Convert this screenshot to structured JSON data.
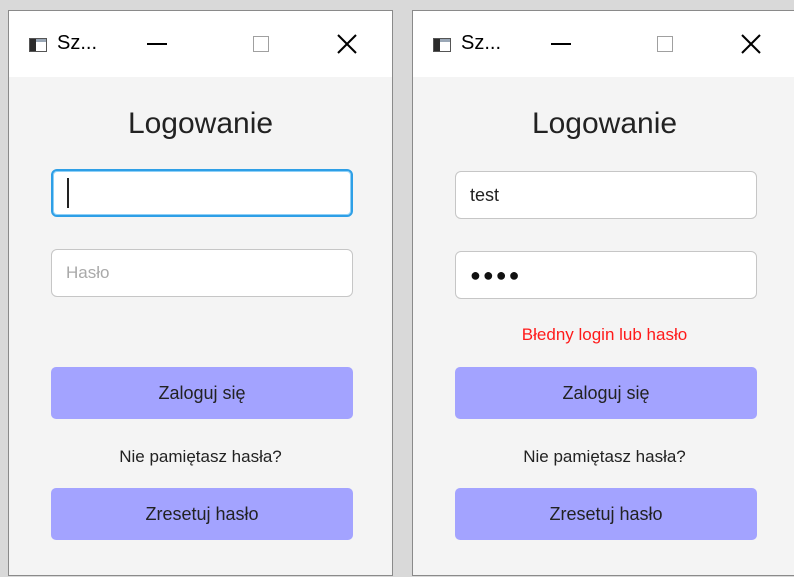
{
  "left": {
    "title": "Sz...",
    "heading": "Logowanie",
    "login_value": "",
    "password_placeholder": "Hasło",
    "login_button": "Zaloguj się",
    "forgot_text": "Nie pamiętasz hasła?",
    "reset_button": "Zresetuj hasło"
  },
  "right": {
    "title": "Sz...",
    "heading": "Logowanie",
    "login_value": "test",
    "password_masked": "●●●●",
    "error": "Błedny login lub hasło",
    "login_button": "Zaloguj się",
    "forgot_text": "Nie pamiętasz hasła?",
    "reset_button": "Zresetuj hasło"
  },
  "colors": {
    "button_bg": "#a3a3ff",
    "error_text": "#ff1a1a",
    "focus_border": "#2e9fe6"
  }
}
